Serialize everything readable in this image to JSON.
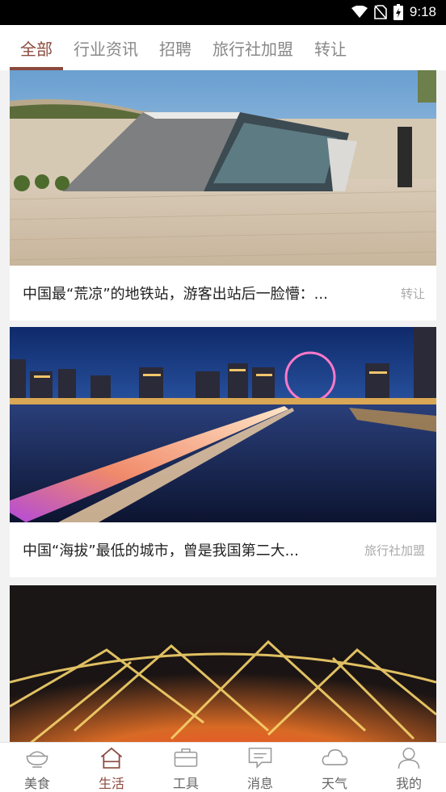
{
  "status": {
    "time": "9:18",
    "icons": [
      "wifi-icon",
      "no-sim-icon",
      "battery-charging-icon"
    ]
  },
  "tabs": [
    {
      "label": "全部",
      "active": true
    },
    {
      "label": "行业资讯",
      "active": false
    },
    {
      "label": "招聘",
      "active": false
    },
    {
      "label": "旅行社加盟",
      "active": false
    },
    {
      "label": "转让",
      "active": false
    }
  ],
  "articles": [
    {
      "title": "中国最“荒凉”的地铁站，游客出站后一脸懵：...",
      "category": "转让",
      "image": "modern-glass-metro-entrance"
    },
    {
      "title": "中国“海拔”最低的城市，曾是我国第二大...",
      "category": "旅行社加盟",
      "image": "night-river-ferris-wheel-light-trails"
    },
    {
      "title": "",
      "category": "",
      "image": "illuminated-birds-nest-stadium"
    }
  ],
  "bottom_nav": [
    {
      "label": "美食",
      "icon": "bowl-icon",
      "active": false
    },
    {
      "label": "生活",
      "icon": "home-icon",
      "active": true
    },
    {
      "label": "工具",
      "icon": "toolbox-icon",
      "active": false
    },
    {
      "label": "消息",
      "icon": "message-icon",
      "active": false
    },
    {
      "label": "天气",
      "icon": "cloud-icon",
      "active": false
    },
    {
      "label": "我的",
      "icon": "user-icon",
      "active": false
    }
  ],
  "colors": {
    "accent": "#8a4a3c",
    "inactive": "#888888"
  }
}
